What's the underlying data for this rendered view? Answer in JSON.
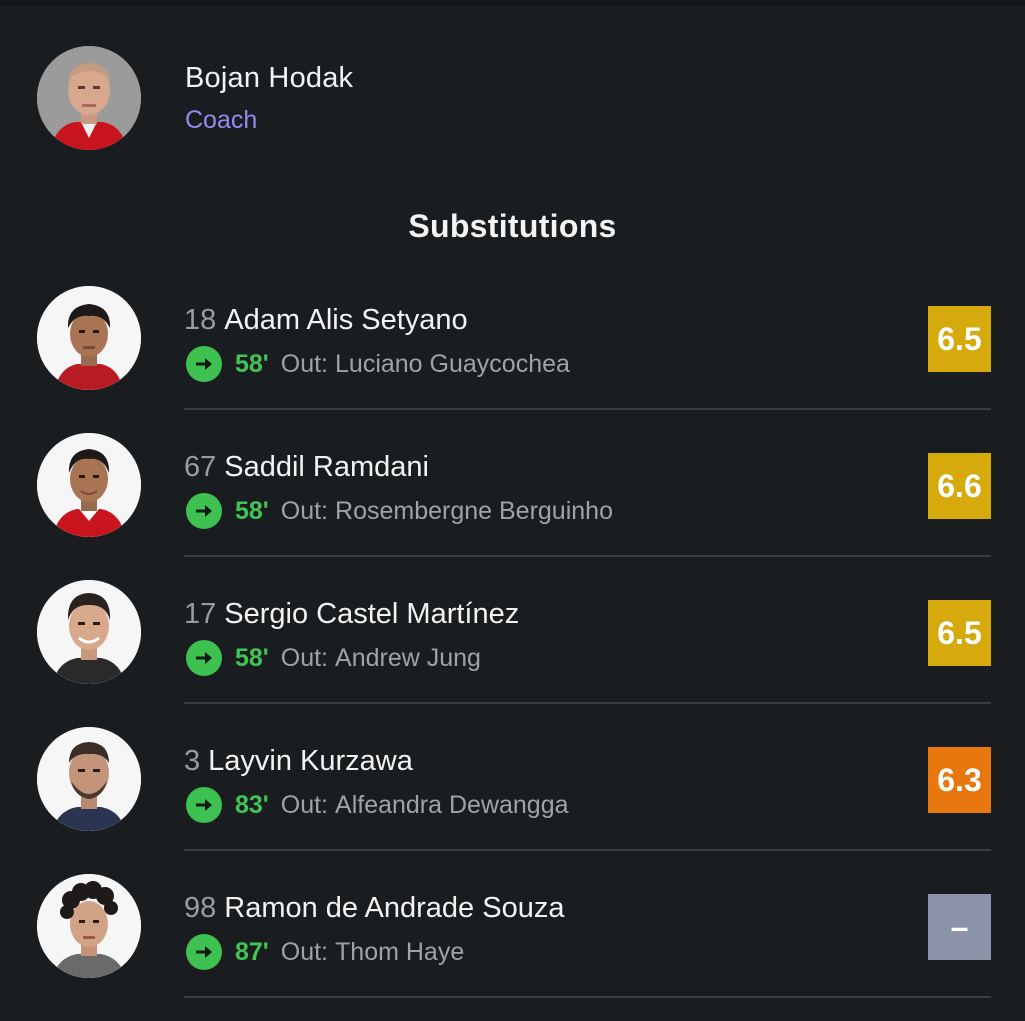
{
  "coach": {
    "name": "Bojan Hodak",
    "role": "Coach",
    "avatar_icon": "coach-photo"
  },
  "section_title": "Substitutions",
  "substitutions": [
    {
      "number": "18",
      "name": "Adam Alis Setyano",
      "minute": "58'",
      "out_prefix": "Out:",
      "out_name": "Luciano Guaycochea",
      "rating": "6.5",
      "rating_color": "#d6a90c",
      "icon": "sub-in-arrow-icon"
    },
    {
      "number": "67",
      "name": "Saddil Ramdani",
      "minute": "58'",
      "out_prefix": "Out:",
      "out_name": "Rosembergne Berguinho",
      "rating": "6.6",
      "rating_color": "#d6a90c",
      "icon": "sub-in-arrow-icon"
    },
    {
      "number": "17",
      "name": "Sergio Castel Martínez",
      "minute": "58'",
      "out_prefix": "Out:",
      "out_name": "Andrew Jung",
      "rating": "6.5",
      "rating_color": "#d6a90c",
      "icon": "sub-in-arrow-icon"
    },
    {
      "number": "3",
      "name": "Layvin Kurzawa",
      "minute": "83'",
      "out_prefix": "Out:",
      "out_name": "Alfeandra Dewangga",
      "rating": "6.3",
      "rating_color": "#e8780e",
      "icon": "sub-in-arrow-icon"
    },
    {
      "number": "98",
      "name": "Ramon de Andrade Souza",
      "minute": "87'",
      "out_prefix": "Out:",
      "out_name": "Thom Haye",
      "rating": "–",
      "rating_color": "#8a93a8",
      "icon": "sub-in-arrow-icon"
    }
  ],
  "colors": {
    "background": "#1a1d1f",
    "accent_role": "#8f8cf2",
    "sub_green": "#3fc152"
  }
}
